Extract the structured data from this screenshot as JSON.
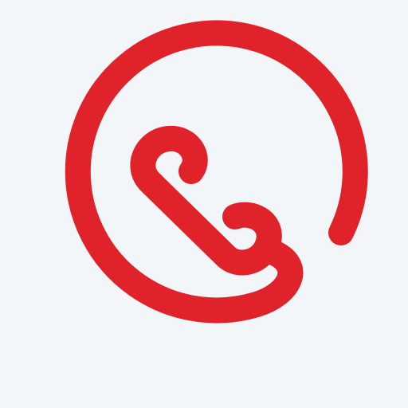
{
  "icon": {
    "name": "phone-handset-circle-logo",
    "color": "#e0232a",
    "background": "#f3f6f9"
  }
}
